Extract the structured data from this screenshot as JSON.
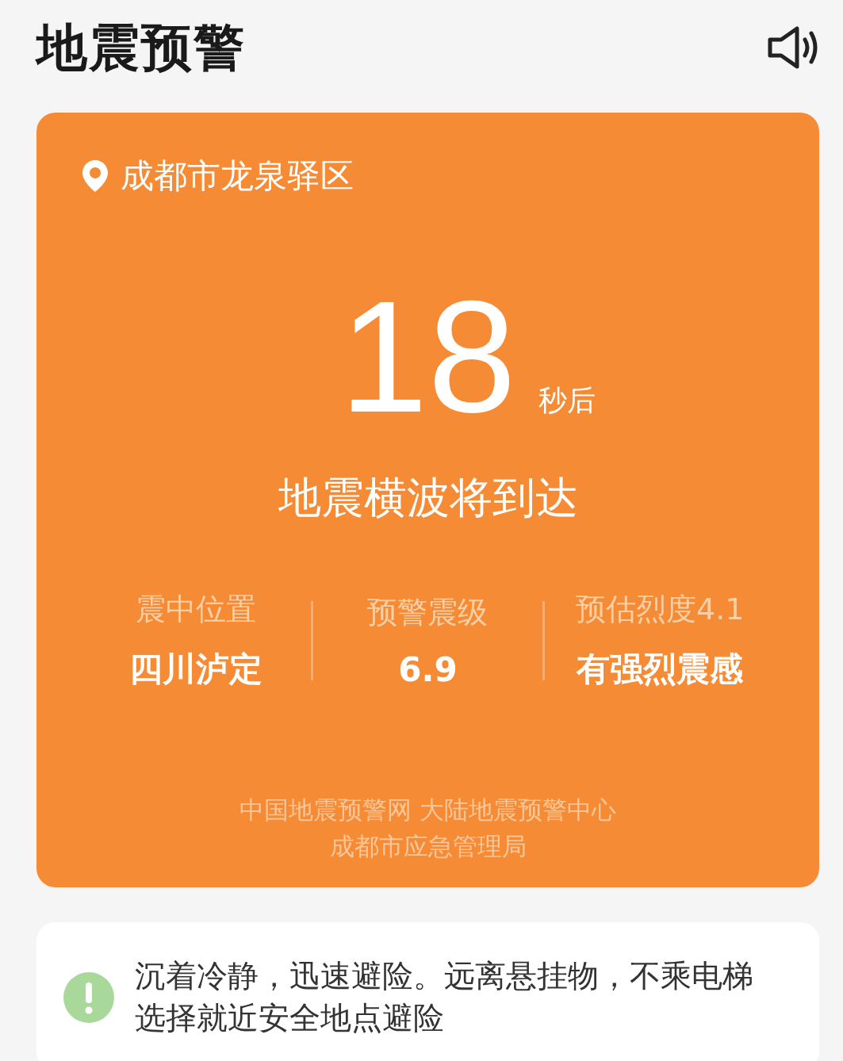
{
  "header": {
    "title": "地震预警"
  },
  "alert": {
    "location": "成都市龙泉驿区",
    "countdown": "18",
    "countdown_unit": "秒后",
    "message": "地震横波将到达",
    "stats": [
      {
        "label": "震中位置",
        "value": "四川泸定"
      },
      {
        "label": "预警震级",
        "value": "6.9"
      },
      {
        "label": "预估烈度4.1",
        "value": "有强烈震感"
      }
    ],
    "sources": [
      "中国地震预警网 大陆地震预警中心",
      "成都市应急管理局"
    ]
  },
  "advice": {
    "text": "沉着冷静，迅速避险。远离悬挂物，不乘电梯选择就近安全地点避险"
  }
}
